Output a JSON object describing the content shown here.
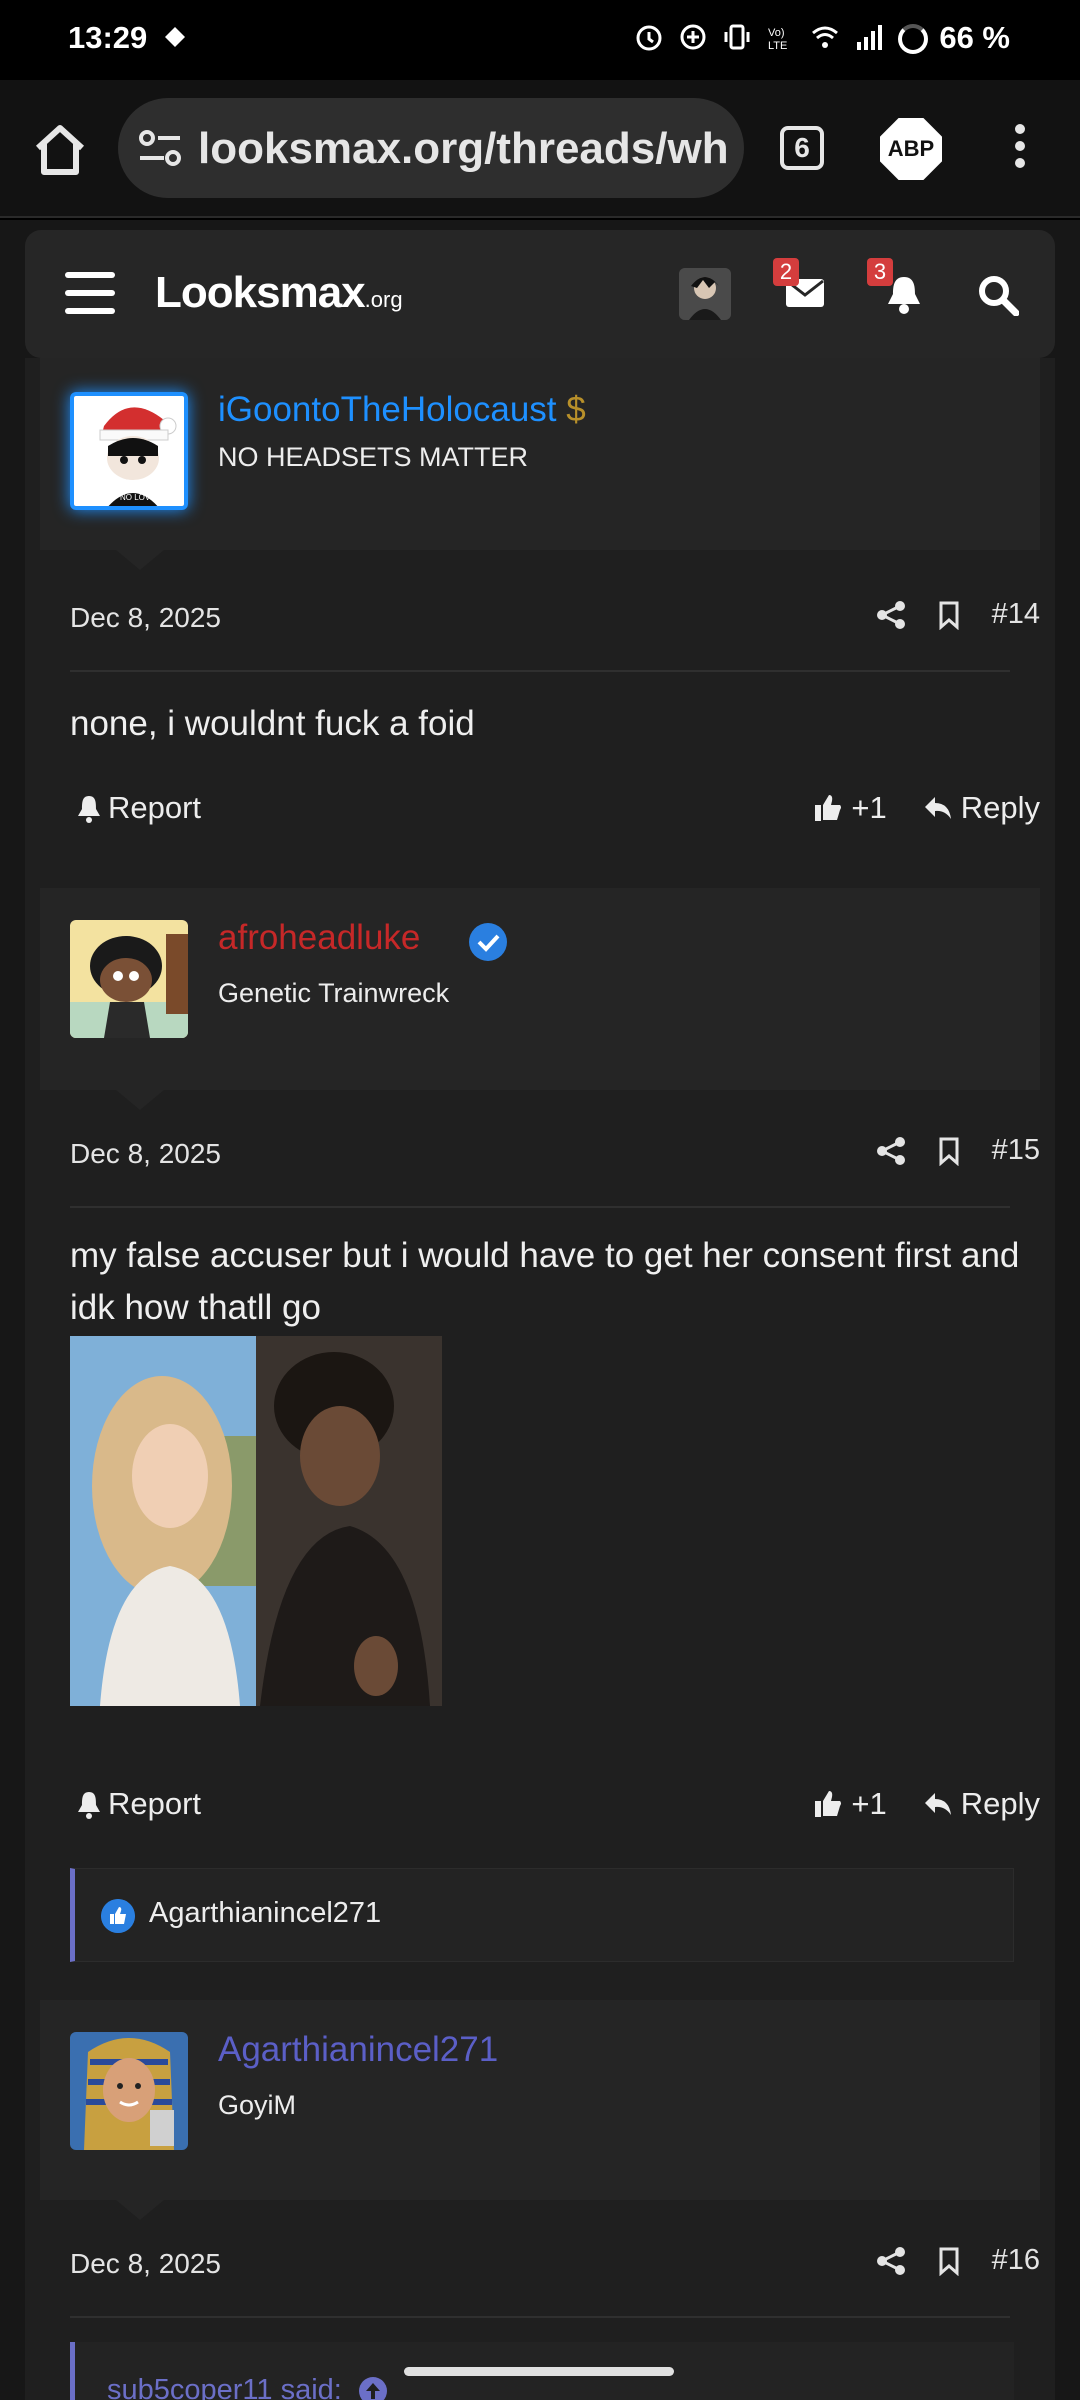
{
  "status_bar": {
    "time": "13:29",
    "battery": "66 %"
  },
  "browser": {
    "url": "looksmax.org/threads/wh",
    "tab_count": "6",
    "adblock_label": "ABP"
  },
  "site": {
    "logo_main": "Looksmax",
    "logo_suffix": ".org",
    "messages_badge": "2",
    "alerts_badge": "3"
  },
  "posts": [
    {
      "username": "iGoontoTheHolocaust",
      "username_color": "#1e90ff",
      "user_title": "NO HEADSETS MATTER",
      "date": "Dec 8, 2025",
      "number": "#14",
      "body": "none, i wouldnt fuck a foid",
      "report_label": "Report",
      "like_count": "+1",
      "reply_label": "Reply"
    },
    {
      "username": "afroheadluke",
      "username_color": "#c62828",
      "user_title": "Genetic Trainwreck",
      "date": "Dec 8, 2025",
      "number": "#15",
      "body": "my false accuser but i would have to get her consent first and idk how thatll go",
      "report_label": "Report",
      "like_count": "+1",
      "reply_label": "Reply",
      "reactions": "Agarthianincel271"
    },
    {
      "username": "Agarthianincel271",
      "username_color": "#5b5fc7",
      "user_title": "GoyiM",
      "date": "Dec 8, 2025",
      "number": "#16",
      "quote_author": "sub5coper11 said:"
    }
  ]
}
